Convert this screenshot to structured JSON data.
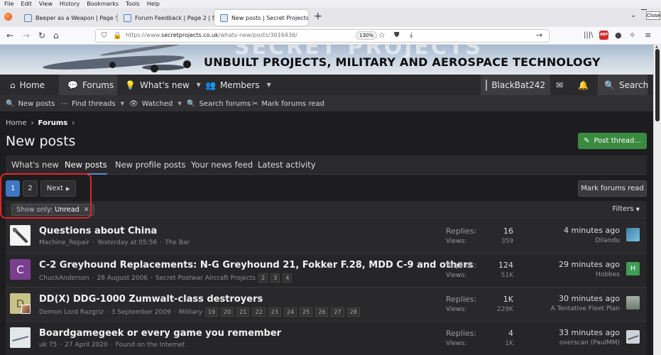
{
  "browser": {
    "menu": [
      "File",
      "Edit",
      "View",
      "History",
      "Bookmarks",
      "Tools",
      "Help"
    ],
    "close_label": "Close",
    "tabs": [
      {
        "label": "Beeper as a Weapon | Page 5 | S"
      },
      {
        "label": "Forum Feedback | Page 2 | Secr"
      },
      {
        "label": "New posts | Secret Projects For"
      }
    ],
    "url_prefix": "https://www.",
    "url_domain": "secretprojects.co.uk",
    "url_path": "/whats-new/posts/3016436/",
    "zoom": "130%",
    "abp_label": "ABP"
  },
  "banner": {
    "ghost_text": "SECRET PROJECTS",
    "title": "UNBUILT PROJECTS, MILITARY AND AEROSPACE TECHNOLOGY"
  },
  "nav": {
    "home": "Home",
    "forums": "Forums",
    "whats_new": "What's new",
    "members": "Members",
    "username": "BlackBat242",
    "search": "Search"
  },
  "subnav": {
    "new_posts": "New posts",
    "find_threads": "Find threads",
    "watched": "Watched",
    "search_forums": "Search forums",
    "mark_forums_read": "Mark forums read"
  },
  "breadcrumb": {
    "home": "Home",
    "forums": "Forums"
  },
  "page": {
    "title": "New posts",
    "post_thread": "Post thread...",
    "tabs": [
      "What's new",
      "New posts",
      "New profile posts",
      "Your news feed",
      "Latest activity"
    ],
    "pages": [
      "1",
      "2"
    ],
    "next": "Next",
    "mark_read": "Mark forums read",
    "filter_label": "Show only:",
    "filter_value": "Unread",
    "filters": "Filters",
    "replies_label": "Replies:",
    "views_label": "Views:"
  },
  "threads": [
    {
      "title": "Questions about China",
      "author": "Machine_Repair",
      "date": "Yesterday at 05:56",
      "forum": "The Bar",
      "pages": [],
      "replies": "16",
      "views": "359",
      "last_time": "4 minutes ago",
      "last_user": "Dilandu",
      "avatar_letter": "",
      "avatar_color": "#eaeaea",
      "last_avatar_letter": "",
      "last_avatar_color": "#3f7fa8"
    },
    {
      "title": "C-2 Greyhound Replacements: N-G Greyhound 21, Fokker F.28, MDD C-9 and others",
      "author": "ChuckAnderson",
      "date": "28 August 2006",
      "forum": "Secret Postwar Aircraft Projects",
      "pages": [
        "2",
        "3",
        "4"
      ],
      "replies": "124",
      "views": "51K",
      "last_time": "29 minutes ago",
      "last_user": "Hobbes",
      "avatar_letter": "C",
      "avatar_color": "#7a3f8f",
      "last_avatar_letter": "H",
      "last_avatar_color": "#3f9e55"
    },
    {
      "title": "DD(X) DDG-1000 Zumwalt-class destroyers",
      "author": "Demon Lord Razgriz",
      "date": "3 September 2009",
      "forum": "Military",
      "pages": [
        "19",
        "20",
        "21",
        "22",
        "23",
        "24",
        "25",
        "26",
        "27",
        "28"
      ],
      "replies": "1K",
      "views": "229K",
      "last_time": "30 minutes ago",
      "last_user": "A Tentative Fleet Plan",
      "avatar_letter": "D",
      "avatar_color": "#c8c28a",
      "last_avatar_letter": "",
      "last_avatar_color": "#8f9a90"
    },
    {
      "title": "Boardgamegeek or every game you remember",
      "author": "uk 75",
      "date": "27 April 2020",
      "forum": "Found on the Internet",
      "pages": [],
      "replies": "4",
      "views": "1K",
      "last_time": "33 minutes ago",
      "last_user": "overscan (PaulMM)",
      "avatar_letter": "",
      "avatar_color": "#d8dbe0",
      "last_avatar_letter": "",
      "last_avatar_color": "#cfd3d8"
    }
  ]
}
